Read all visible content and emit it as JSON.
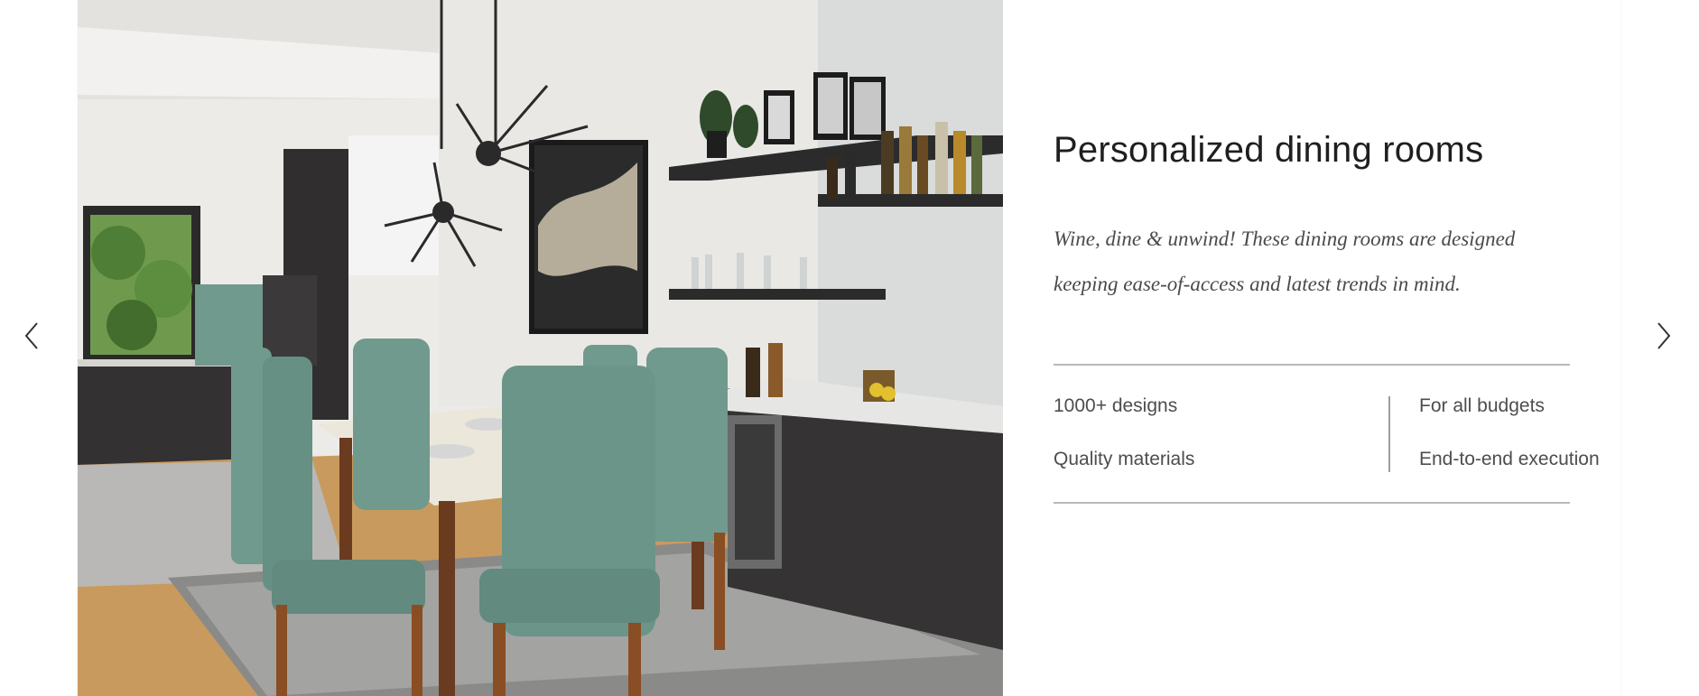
{
  "carousel": {
    "prev_icon": "chevron-left-icon",
    "next_icon": "chevron-right-icon"
  },
  "slide": {
    "image_alt": "Dining room with green upholstered chairs, chandelier and wine bar",
    "title": "Personalized dining rooms",
    "description": "Wine, dine & unwind! These dining rooms are designed keeping ease-of-access and latest trends in mind.",
    "features": [
      "1000+ designs",
      "For all budgets",
      "Quality materials",
      "End-to-end execution"
    ]
  },
  "colors": {
    "chair_green": "#6f9a8d",
    "cabinet_dark": "#363434",
    "table_top": "#ece7db",
    "wood": "#6b3b1f",
    "text_dark": "#1f1f1f",
    "text_body": "#4d4d4d",
    "rule": "#b9b9b9"
  }
}
